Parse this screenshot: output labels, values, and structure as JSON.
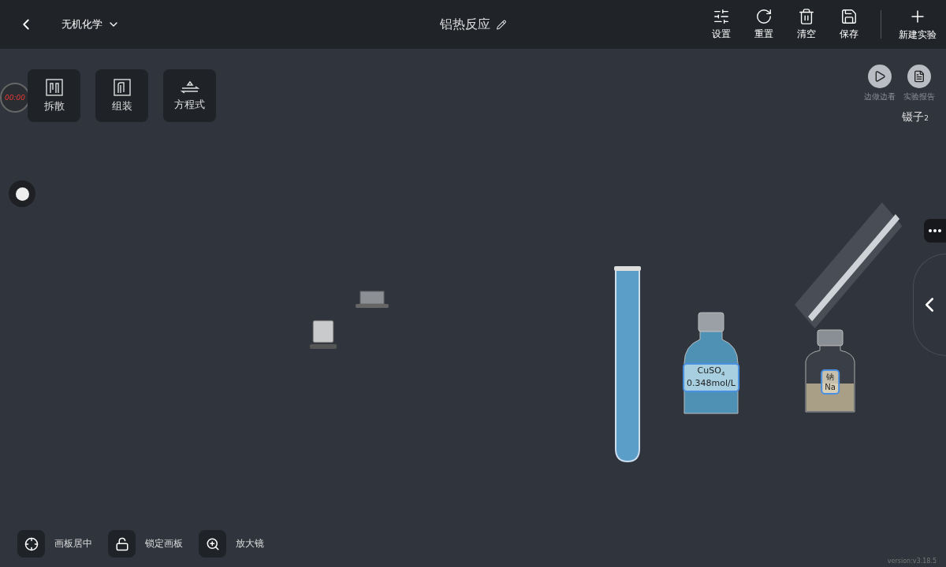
{
  "top_bar": {
    "subject": "无机化学",
    "title": "铝热反应",
    "actions": [
      {
        "kind": "settings",
        "label": "设置"
      },
      {
        "kind": "reset",
        "label": "重置"
      },
      {
        "kind": "clear",
        "label": "清空"
      },
      {
        "kind": "save",
        "label": "保存"
      }
    ],
    "new_experiment": "新建实验"
  },
  "timer": "00:00",
  "tools": [
    {
      "kind": "split",
      "label": "拆散"
    },
    {
      "kind": "assemble",
      "label": "组装"
    },
    {
      "kind": "equation",
      "label": "方程式"
    }
  ],
  "side_buttons": [
    {
      "kind": "video",
      "label": "边做边看"
    },
    {
      "kind": "report",
      "label": "实验报告"
    }
  ],
  "current_tool": "镊子$_{2}$",
  "bottles": [
    {
      "kind": "solution",
      "name": "CuSO$_{4}$",
      "detail": "0.348mol/L"
    },
    {
      "kind": "solid",
      "name": "钠",
      "detail": "Na"
    }
  ],
  "bottom_tools": [
    {
      "kind": "center",
      "label": "画板居中"
    },
    {
      "kind": "lock",
      "label": "锁定画板"
    },
    {
      "kind": "magnifier",
      "label": "放大镜"
    }
  ],
  "version": "version:v3.18.5"
}
